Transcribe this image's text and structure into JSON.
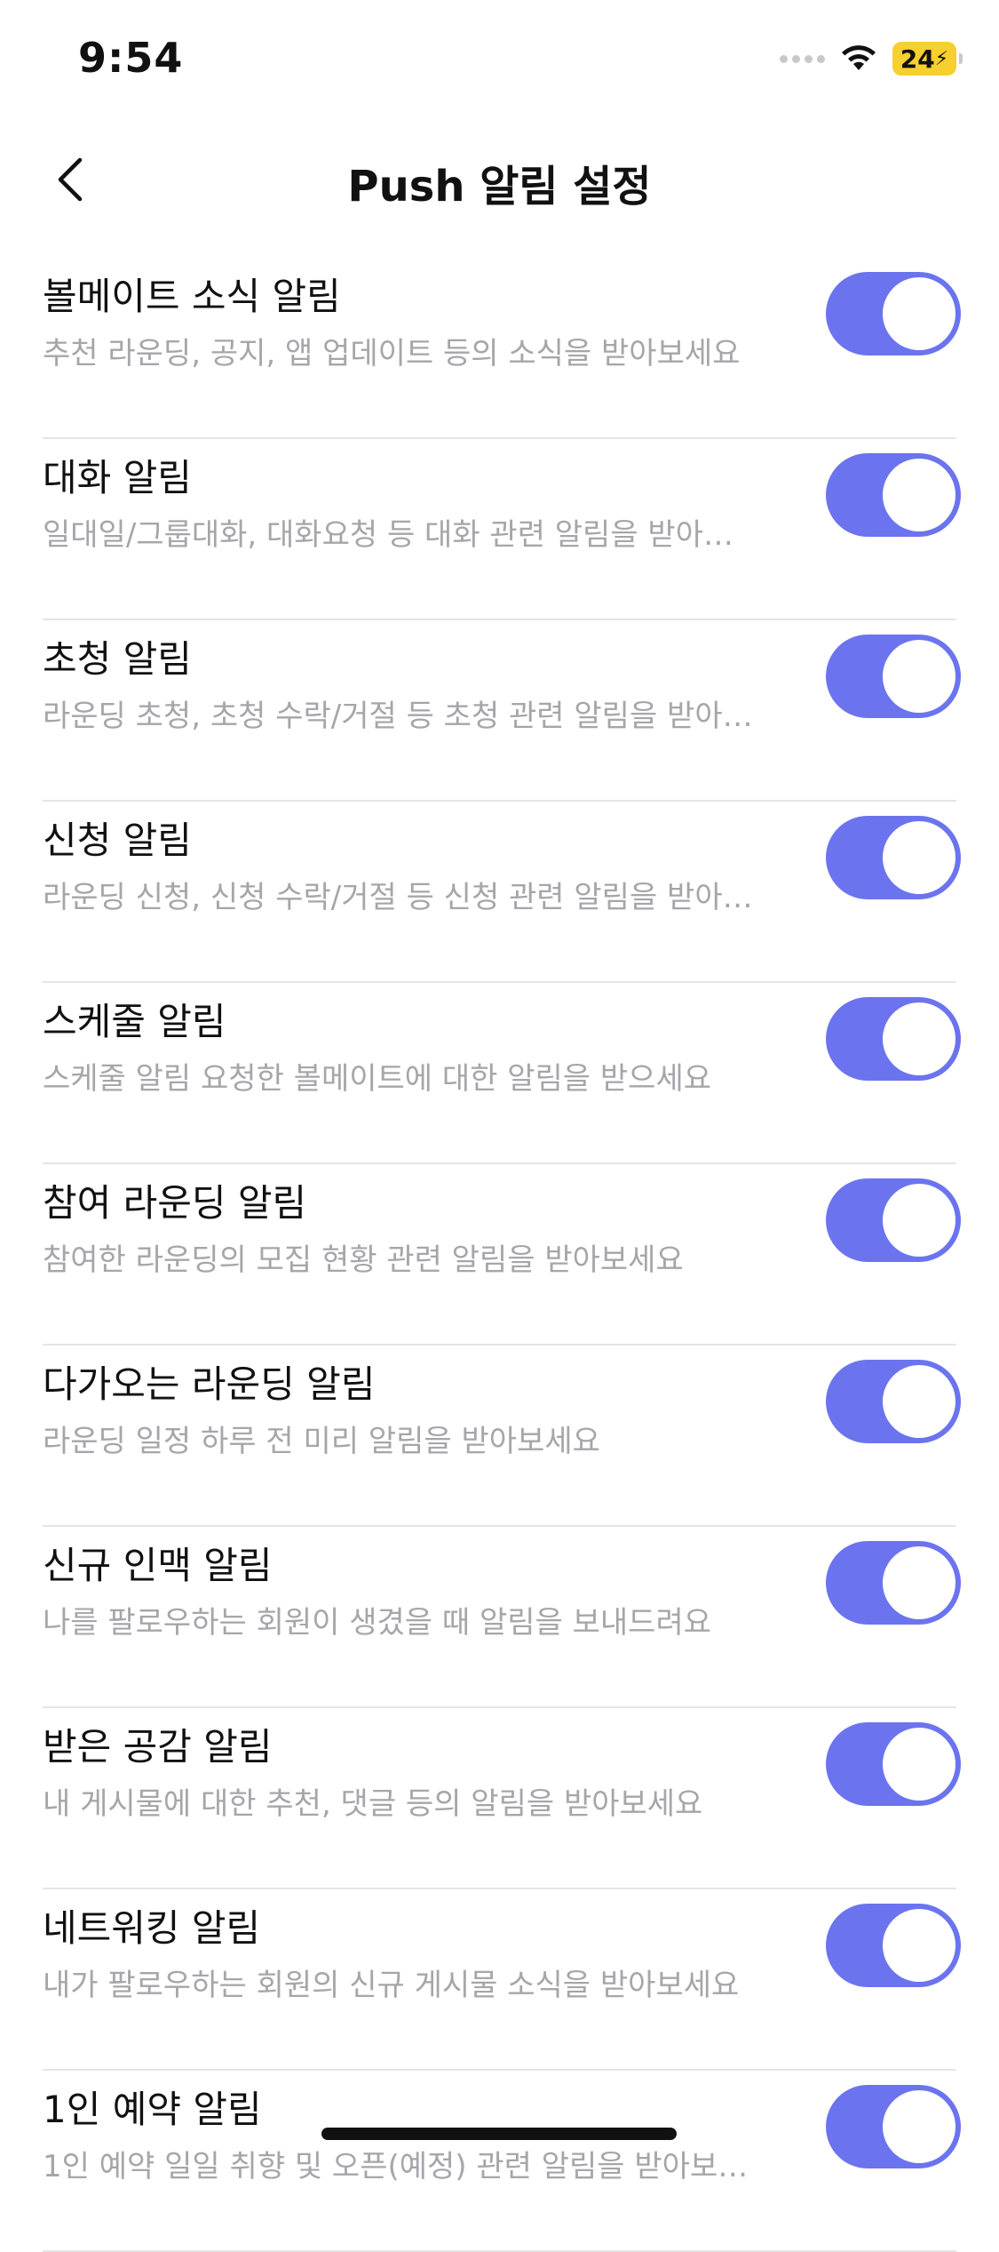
{
  "status_bar": {
    "time": "9:54",
    "battery": "24",
    "battery_color": "#f7cf2f"
  },
  "header": {
    "title": "Push 알림 설정",
    "back_icon": "chevron-left-icon"
  },
  "accent_color": "#6b74ee",
  "settings": [
    {
      "title": "볼메이트 소식 알림",
      "description": "추천 라운딩, 공지, 앱 업데이트 등의 소식을 받아보세요",
      "enabled": true
    },
    {
      "title": "대화 알림",
      "description": "일대일/그룹대화, 대화요청 등 대화 관련 알림을 받아…",
      "enabled": true
    },
    {
      "title": "초청 알림",
      "description": "라운딩 초청, 초청 수락/거절 등 초청 관련 알림을 받아…",
      "enabled": true
    },
    {
      "title": "신청 알림",
      "description": "라운딩 신청, 신청 수락/거절 등 신청 관련 알림을 받아…",
      "enabled": true
    },
    {
      "title": "스케줄 알림",
      "description": "스케줄 알림 요청한 볼메이트에 대한 알림을 받으세요",
      "enabled": true
    },
    {
      "title": "참여 라운딩 알림",
      "description": "참여한 라운딩의 모집 현황 관련 알림을 받아보세요",
      "enabled": true
    },
    {
      "title": "다가오는 라운딩 알림",
      "description": "라운딩 일정 하루 전 미리 알림을 받아보세요",
      "enabled": true
    },
    {
      "title": "신규 인맥 알림",
      "description": "나를 팔로우하는 회원이 생겼을 때 알림을 보내드려요",
      "enabled": true
    },
    {
      "title": "받은 공감 알림",
      "description": "내 게시물에 대한 추천, 댓글 등의 알림을 받아보세요",
      "enabled": true
    },
    {
      "title": "네트워킹 알림",
      "description": "내가 팔로우하는 회원의 신규 게시물 소식을 받아보세요",
      "enabled": true
    },
    {
      "title": "1인 예약 알림",
      "description": "1인 예약 일일 취향 및 오픈(예정) 관련 알림을 받아보…",
      "enabled": true
    }
  ]
}
